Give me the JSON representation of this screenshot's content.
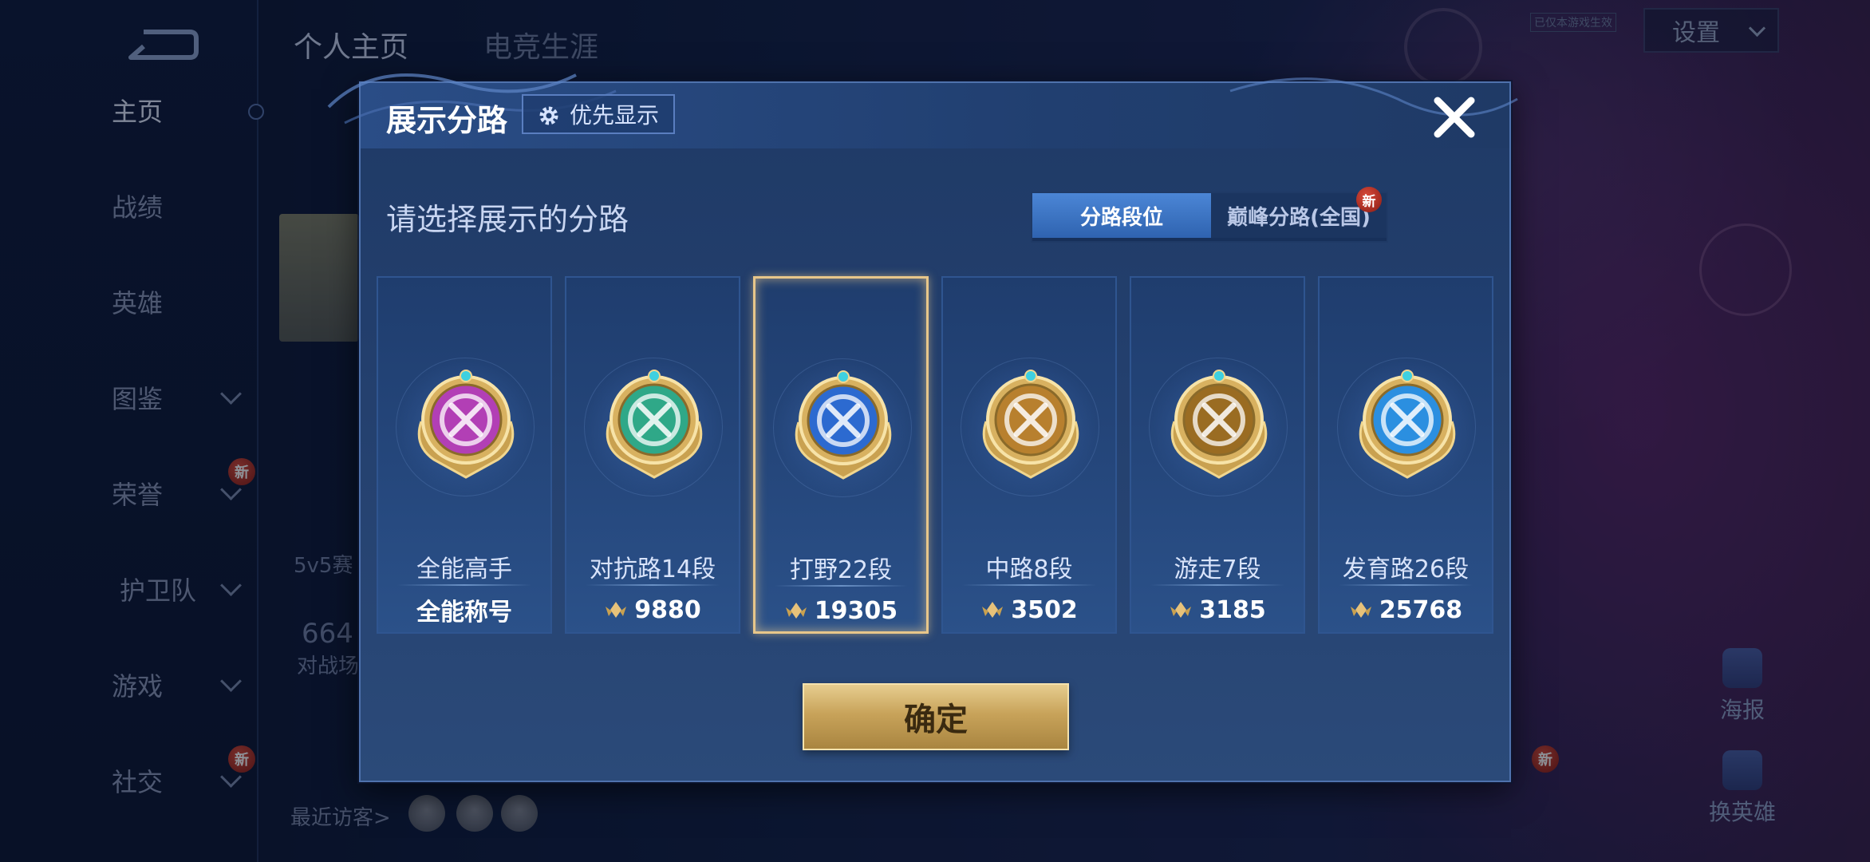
{
  "topTabs": [
    "个人主页",
    "电竞生涯"
  ],
  "leftNav": [
    {
      "label": "主页",
      "active": true,
      "chevron": false,
      "badge": ""
    },
    {
      "label": "战绩",
      "active": false,
      "chevron": false,
      "badge": ""
    },
    {
      "label": "英雄",
      "active": false,
      "chevron": false,
      "badge": ""
    },
    {
      "label": "图鉴",
      "active": false,
      "chevron": true,
      "badge": ""
    },
    {
      "label": "荣誉",
      "active": false,
      "chevron": true,
      "badge": "新"
    },
    {
      "label": "护卫队",
      "active": false,
      "chevron": true,
      "badge": ""
    },
    {
      "label": "游戏",
      "active": false,
      "chevron": true,
      "badge": ""
    },
    {
      "label": "社交",
      "active": false,
      "chevron": true,
      "badge": "新"
    }
  ],
  "settings": {
    "label": "设置"
  },
  "topNote": "已仅本游戏生效",
  "background": {
    "profileNum": "664",
    "profileSub": "对战场",
    "modeLabel": "5v5赛",
    "visitorsLabel": "最近访客>",
    "posterLabel": "海报",
    "switchHeroLabel": "换英雄",
    "switchBadge": "新"
  },
  "dialog": {
    "title": "展示分路",
    "priorityLabel": "优先显示",
    "subtitle": "请选择展示的分路",
    "segment": {
      "on": "分路段位",
      "off": "巅峰分路(全国)",
      "badge": "新"
    },
    "cards": [
      {
        "name": "全能高手",
        "score": "全能称号",
        "hasIcon": false,
        "selected": false,
        "color": "#b23fb5",
        "icon": "allround-emblem-icon"
      },
      {
        "name": "对抗路14段",
        "score": "9880",
        "hasIcon": true,
        "selected": false,
        "color": "#2fa888",
        "icon": "clash-lane-emblem-icon"
      },
      {
        "name": "打野22段",
        "score": "19305",
        "hasIcon": true,
        "selected": true,
        "color": "#2c6ad0",
        "icon": "jungle-emblem-icon"
      },
      {
        "name": "中路8段",
        "score": "3502",
        "hasIcon": true,
        "selected": false,
        "color": "#b8802e",
        "icon": "mid-lane-emblem-icon"
      },
      {
        "name": "游走7段",
        "score": "3185",
        "hasIcon": true,
        "selected": false,
        "color": "#9a6c22",
        "icon": "roam-emblem-icon"
      },
      {
        "name": "发育路26段",
        "score": "25768",
        "hasIcon": true,
        "selected": false,
        "color": "#2b8fe0",
        "icon": "farm-lane-emblem-icon"
      }
    ],
    "confirmLabel": "确定"
  }
}
